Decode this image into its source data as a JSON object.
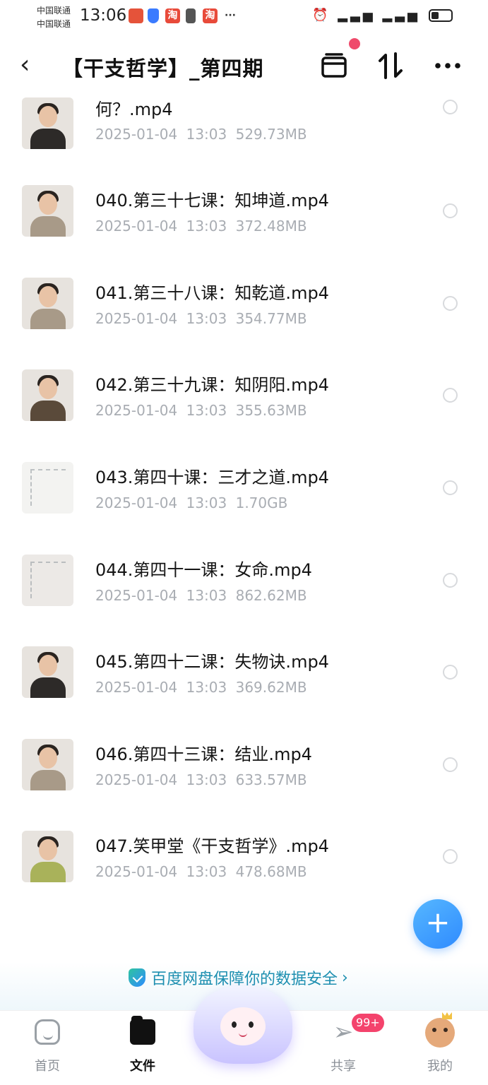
{
  "status_bar": {
    "carrier_1": "中国联通",
    "carrier_2": "中国联通",
    "time": "13:06",
    "icons": [
      "huawei-app-icon",
      "shield-icon",
      "taobao-icon",
      "sim-icon",
      "taobao-icon",
      "more-dots"
    ],
    "right_icons": [
      "alarm-icon",
      "4g-signal-icon",
      "5g-signal-icon",
      "battery-icon"
    ],
    "more": "···"
  },
  "title_bar": {
    "title": "【干支哲学】_第四期",
    "back_icon": "back-icon",
    "actions": [
      "transfer-list-icon",
      "sort-icon",
      "more-icon"
    ]
  },
  "files": [
    {
      "name": "何？.mp4",
      "date": "2025-01-04",
      "time": "13:03",
      "size": "529.73MB",
      "thumb": "person"
    },
    {
      "name": "040.第三十七课：知坤道.mp4",
      "date": "2025-01-04",
      "time": "13:03",
      "size": "372.48MB",
      "thumb": "person"
    },
    {
      "name": "041.第三十八课：知乾道.mp4",
      "date": "2025-01-04",
      "time": "13:03",
      "size": "354.77MB",
      "thumb": "person"
    },
    {
      "name": "042.第三十九课：知阴阳.mp4",
      "date": "2025-01-04",
      "time": "13:03",
      "size": "355.63MB",
      "thumb": "person"
    },
    {
      "name": "043.第四十课：三才之道.mp4",
      "date": "2025-01-04",
      "time": "13:03",
      "size": "1.70GB",
      "thumb": "board"
    },
    {
      "name": "044.第四十一课：女命.mp4",
      "date": "2025-01-04",
      "time": "13:03",
      "size": "862.62MB",
      "thumb": "board"
    },
    {
      "name": "045.第四十二课：失物诀.mp4",
      "date": "2025-01-04",
      "time": "13:03",
      "size": "369.62MB",
      "thumb": "person"
    },
    {
      "name": "046.第四十三课：结业.mp4",
      "date": "2025-01-04",
      "time": "13:03",
      "size": "633.57MB",
      "thumb": "person"
    },
    {
      "name": "047.笑甲堂《干支哲学》.mp4",
      "date": "2025-01-04",
      "time": "13:03",
      "size": "478.68MB",
      "thumb": "person"
    }
  ],
  "fab": {
    "label": "+"
  },
  "banner": {
    "text": "百度网盘保障你的数据安全",
    "chevron": "›"
  },
  "bottom_nav": {
    "items": [
      {
        "label": "首页",
        "icon": "home-icon",
        "active": false
      },
      {
        "label": "文件",
        "icon": "files-icon",
        "active": true
      },
      {
        "label": "",
        "icon": "ai-mascot-icon",
        "active": false
      },
      {
        "label": "共享",
        "icon": "share-icon",
        "active": false,
        "badge": "99+"
      },
      {
        "label": "我的",
        "icon": "profile-avatar-icon",
        "active": false
      }
    ]
  },
  "colors": {
    "accent": "#2f8bff",
    "badge": "#f4436c",
    "meta_text": "#a9adb3",
    "banner_text": "#1d8fb0"
  }
}
